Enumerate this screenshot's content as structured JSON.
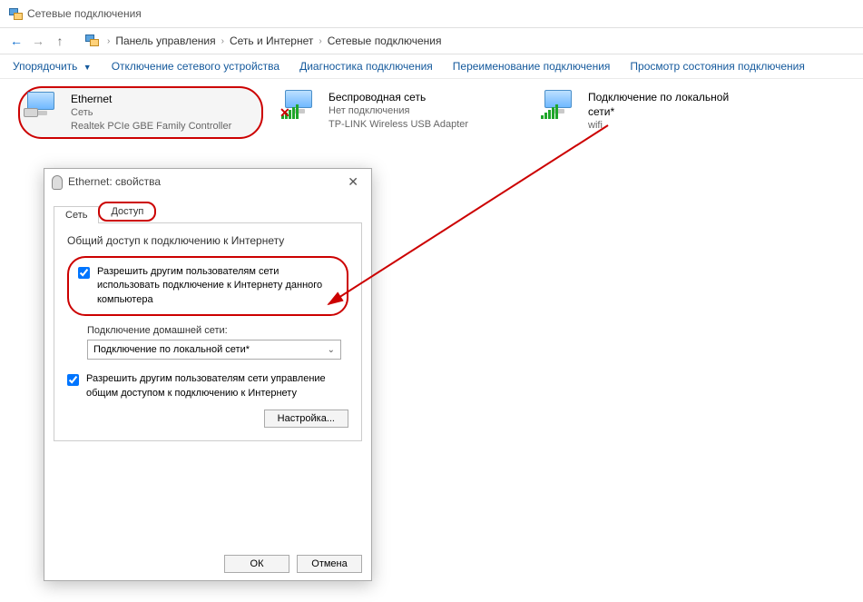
{
  "window": {
    "title": "Сетевые подключения"
  },
  "breadcrumb": {
    "root": "Панель управления",
    "mid": "Сеть и Интернет",
    "leaf": "Сетевые подключения"
  },
  "toolbar": {
    "organize": "Упорядочить",
    "disable": "Отключение сетевого устройства",
    "diagnose": "Диагностика подключения",
    "rename": "Переименование подключения",
    "status": "Просмотр состояния подключения"
  },
  "connections": [
    {
      "name": "Ethernet",
      "line2": "Сеть",
      "line3": "Realtek PCIe GBE Family Controller",
      "type": "wired",
      "selected": true
    },
    {
      "name": "Беспроводная сеть",
      "line2": "Нет подключения",
      "line3": "TP-LINK Wireless USB Adapter",
      "type": "wifi-off",
      "selected": false
    },
    {
      "name": "Подключение по локальной сети*",
      "line2": "wifi",
      "line3": "",
      "type": "wifi-on",
      "selected": false
    }
  ],
  "dialog": {
    "title": "Ethernet: свойства",
    "tabs": {
      "net": "Сеть",
      "share": "Доступ"
    },
    "group_title": "Общий доступ к подключению к Интернету",
    "chk1": "Разрешить другим пользователям сети использовать подключение к Интернету данного компьютера",
    "home_label": "Подключение домашней сети:",
    "dropdown": "Подключение по локальной сети*",
    "chk2": "Разрешить другим пользователям сети управление общим доступом к подключению к Интернету",
    "settings_btn": "Настройка...",
    "ok": "ОК",
    "cancel": "Отмена"
  }
}
